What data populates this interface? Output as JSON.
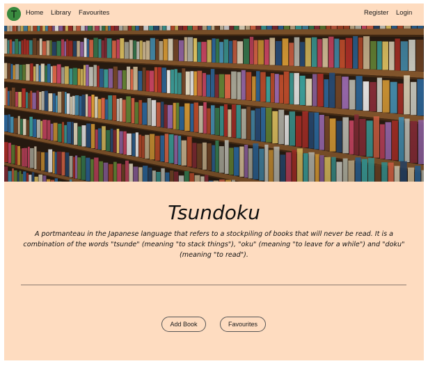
{
  "navbar": {
    "logo_letter": "T",
    "links": [
      {
        "label": "Home"
      },
      {
        "label": "Library"
      },
      {
        "label": "Favourites"
      }
    ],
    "register_label": "Register",
    "login_label": "Login"
  },
  "hero": {
    "image_subject": "library-bookshelves-photo"
  },
  "main": {
    "title": "Tsundoku",
    "description": "A portmanteau in the Japanese language that refers to a stockpiling of books that will never be read. It is a combination of the words \"tsunde\" (meaning \"to stack things\"), \"oku\" (meaning \"to leave for a while\") and \"doku\" (meaning \"to read\").",
    "add_book_label": "Add Book",
    "favourites_label": "Favourites"
  },
  "colors": {
    "page_background": "#fedcc0",
    "logo_green": "#3a8a3f",
    "text": "#111111"
  }
}
